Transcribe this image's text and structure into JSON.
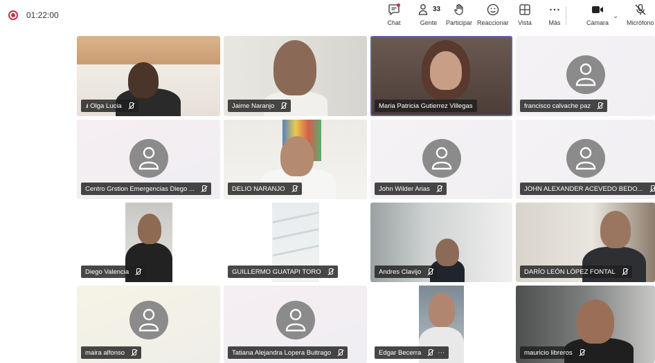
{
  "header": {
    "timer": "01:22:00",
    "people_count": "33",
    "toolbar": {
      "chat": "Chat",
      "people": "Gente",
      "raise": "Participar",
      "react": "Reaccionar",
      "view": "Vista",
      "more": "Más",
      "camera": "Cámara",
      "mic": "Micrófono"
    }
  },
  "participants": [
    {
      "name": "Olga Lucia",
      "muted": true,
      "speaking": true
    },
    {
      "name": "Jaime Naranjo",
      "muted": true
    },
    {
      "name": "Maria Patricia Gutierrez Villegas",
      "muted": false,
      "selected": true
    },
    {
      "name": "francisco calvache paz",
      "muted": true,
      "avatar": true
    },
    {
      "name": "Centro Grstion Emergencias Diego ...",
      "muted": true,
      "avatar": true
    },
    {
      "name": "DELIO NARANJO",
      "muted": true
    },
    {
      "name": "John Wilder Arias",
      "muted": true,
      "avatar": true
    },
    {
      "name": "JOHN ALEXANDER ACEVEDO BEDO...",
      "muted": true,
      "avatar": true
    },
    {
      "name": "Diego Valencia",
      "muted": true
    },
    {
      "name": "GUILLERMO GUATAPI TORO",
      "muted": true
    },
    {
      "name": "Andres Clavijo",
      "muted": true
    },
    {
      "name": "DARÍO LEÓN LÓPEZ FONTAL",
      "muted": true
    },
    {
      "name": "maira alfonso",
      "muted": true,
      "avatar": true
    },
    {
      "name": "Tatiana Alejandra Lopera Buitrago",
      "muted": true,
      "avatar": true
    },
    {
      "name": "Edgar Becerra",
      "muted": true,
      "more": true
    },
    {
      "name": "mauricio libreros",
      "muted": true
    }
  ],
  "colors": {
    "accent": "#6264a7",
    "record": "#c4314b",
    "label_bg": "#1e1e1e"
  }
}
